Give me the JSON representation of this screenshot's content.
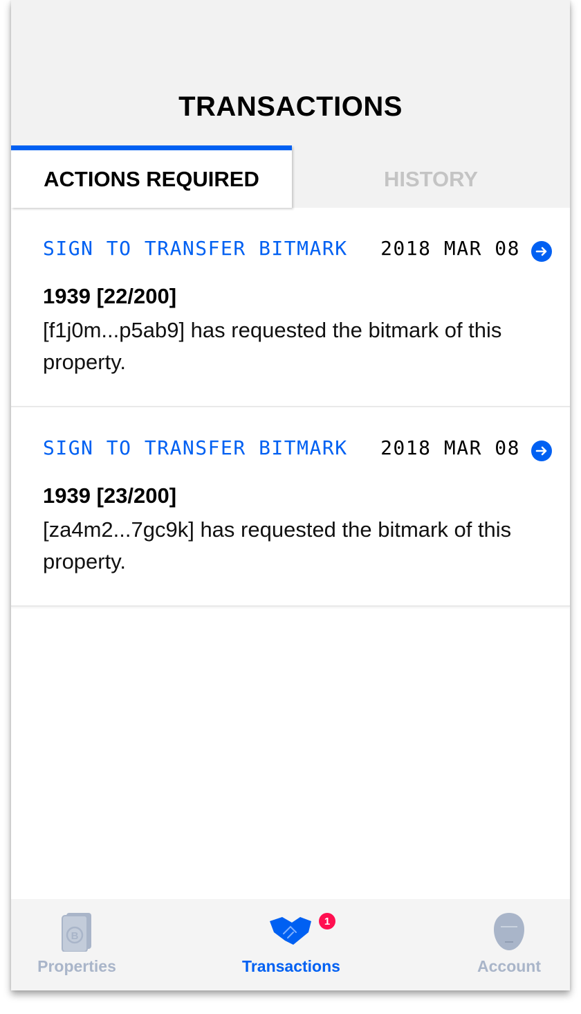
{
  "header": {
    "title": "TRANSACTIONS"
  },
  "tabs": [
    {
      "label": "ACTIONS REQUIRED",
      "active": true
    },
    {
      "label": "HISTORY",
      "active": false
    }
  ],
  "transactions": [
    {
      "action": "SIGN TO TRANSFER BITMARK",
      "date": "2018 MAR 08",
      "title": "1939 [22/200]",
      "description": "[f1j0m...p5ab9] has requested the bitmark of this property."
    },
    {
      "action": "SIGN TO TRANSFER BITMARK",
      "date": "2018 MAR 08",
      "title": "1939 [23/200]",
      "description": "[za4m2...7gc9k] has requested the bitmark of this property."
    }
  ],
  "tabbar": {
    "items": [
      {
        "label": "Properties",
        "icon": "bitmark-properties-icon",
        "active": false
      },
      {
        "label": "Transactions",
        "icon": "handshake-icon",
        "active": true,
        "badge": "1"
      },
      {
        "label": "Account",
        "icon": "account-icon",
        "active": false
      }
    ]
  },
  "colors": {
    "accent": "#0060f2",
    "inactive": "#a9b5c9",
    "badge": "#ff0f50",
    "header_bg": "#f2f2f2"
  }
}
